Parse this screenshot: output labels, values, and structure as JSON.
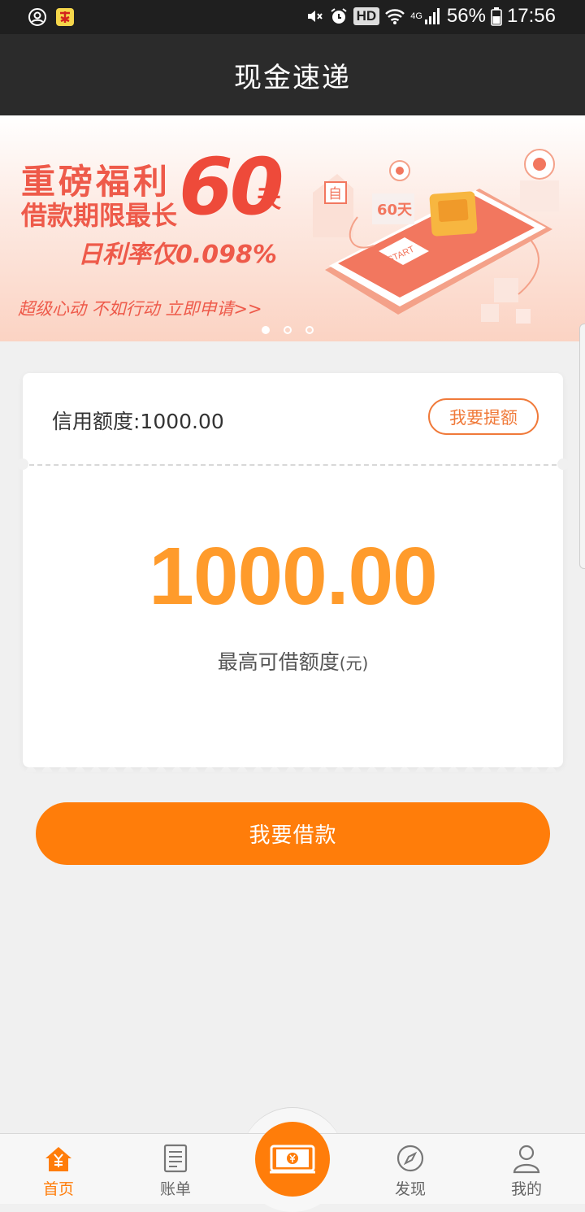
{
  "status_bar": {
    "battery": "56%",
    "time": "17:56",
    "hd_badge": "HD",
    "network": "4G"
  },
  "app_bar": {
    "title": "现金速递"
  },
  "banner": {
    "headline": "重磅福利",
    "line2": "借款期限最长",
    "days_number": "60",
    "days_unit": "天",
    "rate_line": "日利率仅0.098%",
    "cta": "超级心动 不如行动 立即申请>>",
    "phone_badge": "60天",
    "phone_start": "START",
    "house_char": "自",
    "pages": 3,
    "active_page": 1
  },
  "card": {
    "credit_label": "信用额度:1000.00",
    "raise_button": "我要提额",
    "amount": "1000.00",
    "amount_label": "最高可借额度",
    "amount_unit": "(元)"
  },
  "borrow_button": "我要借款",
  "tabs": [
    {
      "label": "首页",
      "icon": "home-yen-icon",
      "active": true
    },
    {
      "label": "账单",
      "icon": "bill-icon",
      "active": false
    },
    {
      "label": "",
      "icon": "cash-money-icon",
      "active": false
    },
    {
      "label": "发现",
      "icon": "compass-icon",
      "active": false
    },
    {
      "label": "我的",
      "icon": "profile-icon",
      "active": false
    }
  ],
  "colors": {
    "accent": "#ff7d0a",
    "amount": "#ff9b2b",
    "banner_red": "#ee5a4a",
    "app_bar": "#2b2b2b"
  }
}
